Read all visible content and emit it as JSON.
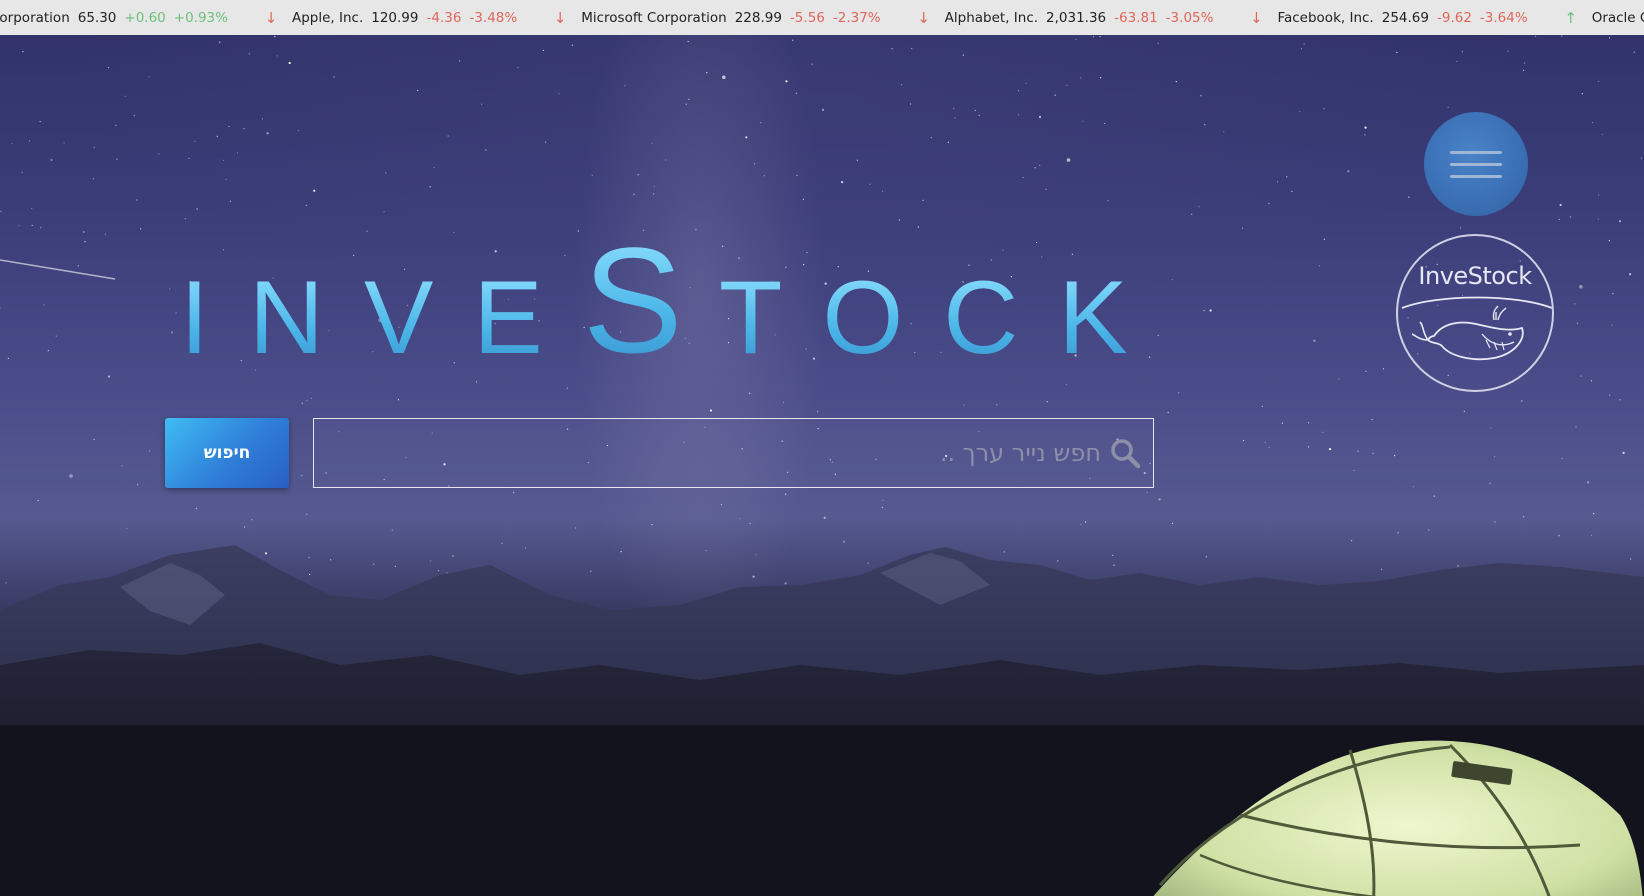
{
  "ticker": [
    {
      "arrow": "",
      "direction": "up",
      "name": "Corporation",
      "price": "65.30",
      "change": "+0.60",
      "percent": "+0.93%"
    },
    {
      "arrow": "↓",
      "direction": "down",
      "name": "Apple, Inc.",
      "price": "120.99",
      "change": "-4.36",
      "percent": "-3.48%"
    },
    {
      "arrow": "↓",
      "direction": "down",
      "name": "Microsoft Corporation",
      "price": "228.99",
      "change": "-5.56",
      "percent": "-2.37%"
    },
    {
      "arrow": "↓",
      "direction": "down",
      "name": "Alphabet, Inc.",
      "price": "2,031.36",
      "change": "-63.81",
      "percent": "-3.05%"
    },
    {
      "arrow": "↓",
      "direction": "down",
      "name": "Facebook, Inc.",
      "price": "254.69",
      "change": "-9.62",
      "percent": "-3.64%"
    },
    {
      "arrow": "↑",
      "direction": "up",
      "name": "Oracle Corp",
      "price": "",
      "change": "",
      "percent": ""
    }
  ],
  "logo": {
    "letters": [
      "I",
      "N",
      "V",
      "E",
      "S",
      "T",
      "O",
      "C",
      "K"
    ],
    "text": "InveStock",
    "accent_color": "#5cc6ef"
  },
  "search": {
    "button_label": "חיפוש",
    "placeholder": "חפש נייר ערך ..",
    "value": "",
    "icon": "search-icon"
  },
  "menu": {
    "icon": "hamburger-menu-icon"
  },
  "badge": {
    "text": "InveStock",
    "icon": "whale-icon"
  },
  "colors": {
    "ticker_bg": "#e7e7e7",
    "down": "#e0665c",
    "up": "#6cc27a",
    "button_gradient_start": "#3fbcf4",
    "button_gradient_end": "#2a5ec4",
    "menu_circle": "#3a6fb4"
  }
}
